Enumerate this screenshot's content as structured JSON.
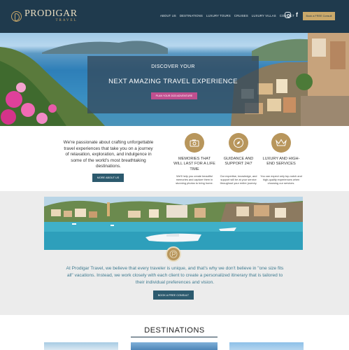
{
  "brand": {
    "name": "PRODIGAR",
    "tagline": "TRAVEL"
  },
  "nav": {
    "items": [
      "ABOUT US",
      "DESTINATIONS",
      "LUXURY TOURS",
      "CRUISES",
      "LUXURY VILLAS",
      "CONTACT"
    ],
    "social": [
      "instagram-icon",
      "facebook-icon"
    ],
    "facebook_glyph": "f",
    "cta": "Book a FREE Consult"
  },
  "hero": {
    "line1": "DISCOVER YOUR",
    "line2": "NEXT AMAZING TRAVEL EXPERIENCE",
    "button": "PLAN YOUR 2023 ADVENTURE"
  },
  "intro": {
    "text": "We're passionate about crafting unforgettable travel experiences that take you on a journey of relaxation, exploration, and indulgence in some of the world's most breathtaking destinations.",
    "button": "MORE ABOUT US"
  },
  "features": [
    {
      "icon": "camera-icon",
      "title": "MEMORIES THAT WILL LAST FOR A LIFE TIME",
      "desc": "We'll help you create beautiful memories and capture them in stunning photos to bring home."
    },
    {
      "icon": "compass-icon",
      "title": "GUIDANCE AND SUPPORT 24/7",
      "desc": "Our expertise, knowledge, and support will be at your service throughout your entire journey."
    },
    {
      "icon": "crown-icon",
      "title": "LUXURY AND HIGH-END SERVICES",
      "desc": "You can expect only top-notch and high-quality experiences when choosing our services."
    }
  ],
  "belief": {
    "text": "At Prodigar Travel, we believe that every traveler is unique, and that's why we don't believe in \"one size fits all\" vacations. Instead, we work closely with each client to create a personalized itinerary that is tailored to their individual preferences and vision.",
    "button": "BOOK A FREE CONSULT"
  },
  "destinations": {
    "title": "DESTINATIONS"
  },
  "colors": {
    "navy": "#1f3a4d",
    "gold": "#c9a86a",
    "teal": "#2c5a6e",
    "pink": "#c04f8f",
    "belief_text": "#3e7a8f"
  }
}
